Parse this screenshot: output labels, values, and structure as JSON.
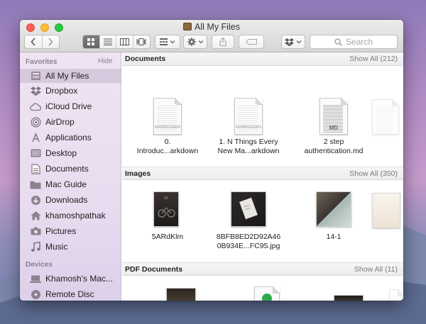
{
  "window": {
    "title": "All My Files"
  },
  "toolbar": {
    "search_placeholder": "Search"
  },
  "sidebar": {
    "favorites_header": "Favorites",
    "hide_label": "Hide",
    "favorites": [
      {
        "label": "All My Files",
        "icon": "all-files-icon",
        "selected": true
      },
      {
        "label": "Dropbox",
        "icon": "dropbox-icon"
      },
      {
        "label": "iCloud Drive",
        "icon": "cloud-icon"
      },
      {
        "label": "AirDrop",
        "icon": "airdrop-icon"
      },
      {
        "label": "Applications",
        "icon": "applications-icon"
      },
      {
        "label": "Desktop",
        "icon": "desktop-icon"
      },
      {
        "label": "Documents",
        "icon": "documents-icon"
      },
      {
        "label": "Mac Guide",
        "icon": "folder-icon"
      },
      {
        "label": "Downloads",
        "icon": "downloads-icon"
      },
      {
        "label": "khamoshpathak",
        "icon": "home-icon"
      },
      {
        "label": "Pictures",
        "icon": "camera-icon"
      },
      {
        "label": "Music",
        "icon": "music-icon"
      }
    ],
    "devices_header": "Devices",
    "devices": [
      {
        "label": "Khamosh's Mac...",
        "icon": "laptop-icon"
      },
      {
        "label": "Remote Disc",
        "icon": "disc-icon"
      }
    ]
  },
  "sections": {
    "documents": {
      "title": "Documents",
      "show_all": "Show All (212)",
      "files": [
        {
          "line1": "0.",
          "line2": "Introduc...arkdown",
          "tag": "MARKDOWN"
        },
        {
          "line1": "1. N Things Every",
          "line2": "New Ma...arkdown",
          "tag": "MARKDOWN"
        },
        {
          "line1": "2 step",
          "line2": "authentication.md",
          "tag": "MD"
        }
      ]
    },
    "images": {
      "title": "Images",
      "show_all": "Show All (350)",
      "files": [
        {
          "line1": "5ARdKlm",
          "line2": ""
        },
        {
          "line1": "8BFB8ED2D92A46",
          "line2": "0B934E...FC95.jpg"
        },
        {
          "line1": "14-1",
          "line2": ""
        }
      ]
    },
    "pdf": {
      "title": "PDF Documents",
      "show_all": "Show All (11)"
    }
  },
  "colors": {
    "selection": "#d7c9dd",
    "sidebar_bg": "#eee2f1",
    "close": "#fc5f57",
    "minimize": "#fdbc2e",
    "maximize": "#28c840"
  }
}
